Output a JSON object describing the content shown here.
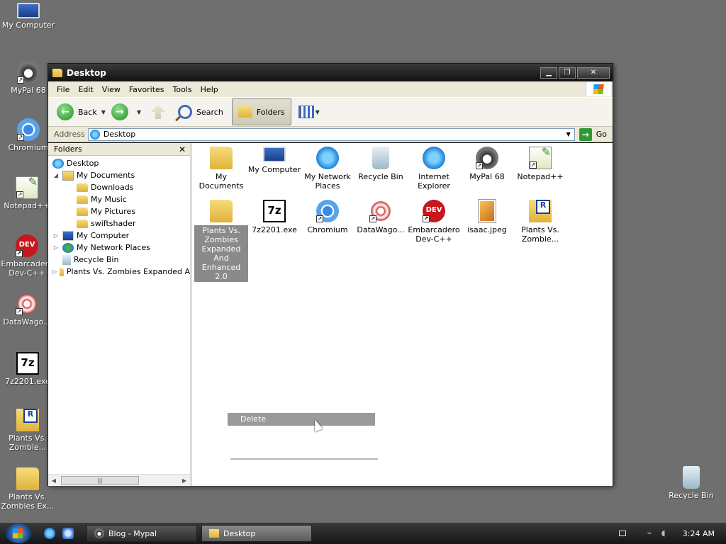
{
  "desktop": {
    "icons": [
      {
        "label": "My Computer",
        "icon": "computer-icon"
      },
      {
        "label": "MyPal 68",
        "icon": "raccoon-icon"
      },
      {
        "label": "Chromium",
        "icon": "chromium-icon"
      },
      {
        "label": "Notepad++",
        "icon": "notepad-plus-plus-icon"
      },
      {
        "label": "Embarcadero Dev-C++",
        "icon": "devcpp-icon"
      },
      {
        "label": "DataWago...",
        "icon": "datawagon-icon"
      },
      {
        "label": "7z2201.exe",
        "icon": "7zip-icon"
      },
      {
        "label": "Plants Vs. Zombie...",
        "icon": "pvz-icon"
      },
      {
        "label": "Plants Vs. Zombies Ex...",
        "icon": "folder-icon"
      },
      {
        "label": "Recycle Bin",
        "icon": "recycle-bin-icon"
      }
    ]
  },
  "window": {
    "title": "Desktop",
    "buttons": {
      "minimize": "▁",
      "maximize": "❐",
      "close": "✕"
    }
  },
  "menu": {
    "items": [
      "File",
      "Edit",
      "View",
      "Favorites",
      "Tools",
      "Help"
    ]
  },
  "toolbar": {
    "back": "Back",
    "search": "Search",
    "folders": "Folders"
  },
  "address": {
    "label": "Address",
    "value": "Desktop",
    "go": "Go"
  },
  "folders_pane": {
    "title": "Folders",
    "tree": [
      {
        "label": "Desktop",
        "level": 0,
        "expand": "",
        "icon": "ie"
      },
      {
        "label": "My Documents",
        "level": 1,
        "expand": "◢",
        "icon": "doc"
      },
      {
        "label": "Downloads",
        "level": 2,
        "expand": "",
        "icon": "folder"
      },
      {
        "label": "My Music",
        "level": 2,
        "expand": "",
        "icon": "folder"
      },
      {
        "label": "My Pictures",
        "level": 2,
        "expand": "",
        "icon": "folder"
      },
      {
        "label": "swiftshader",
        "level": 2,
        "expand": "",
        "icon": "folder"
      },
      {
        "label": "My Computer",
        "level": 1,
        "expand": "▷",
        "icon": "comp"
      },
      {
        "label": "My Network Places",
        "level": 1,
        "expand": "▷",
        "icon": "net"
      },
      {
        "label": "Recycle Bin",
        "level": 1,
        "expand": "",
        "icon": "bin"
      },
      {
        "label": "Plants Vs. Zombies Expanded A",
        "level": 1,
        "expand": "▷",
        "icon": "folder"
      }
    ]
  },
  "files": {
    "items": [
      {
        "label": "My Documents",
        "icon": "folder-icon"
      },
      {
        "label": "My Computer",
        "icon": "computer-icon"
      },
      {
        "label": "My Network Places",
        "icon": "network-places-icon"
      },
      {
        "label": "Recycle Bin",
        "icon": "recycle-bin-icon"
      },
      {
        "label": "Internet Explorer",
        "icon": "internet-explorer-icon"
      },
      {
        "label": "MyPal 68",
        "icon": "raccoon-icon"
      },
      {
        "label": "Notepad++",
        "icon": "notepad-plus-plus-icon"
      },
      {
        "label": "Plants Vs. Zombies Expanded And Enhanced 2.0",
        "icon": "folder-icon",
        "selected": true
      },
      {
        "label": "7z2201.exe",
        "icon": "7zip-icon"
      },
      {
        "label": "Chromium",
        "icon": "chromium-icon"
      },
      {
        "label": "DataWago...",
        "icon": "datawagon-icon"
      },
      {
        "label": "Embarcadero Dev-C++",
        "icon": "devcpp-icon"
      },
      {
        "label": "isaac.jpeg",
        "icon": "image-icon"
      },
      {
        "label": "Plants Vs. Zombie...",
        "icon": "pvz-icon"
      }
    ]
  },
  "context_menu": {
    "items": [
      "Delete"
    ]
  },
  "taskbar": {
    "tasks": [
      {
        "label": "Blog - Mypal",
        "active": false
      },
      {
        "label": "Desktop",
        "active": true
      }
    ],
    "clock": "3:24 AM"
  }
}
